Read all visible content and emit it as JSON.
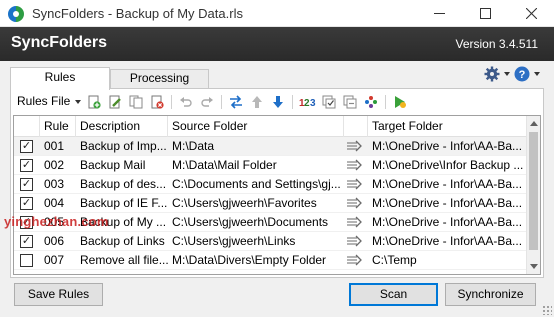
{
  "window": {
    "title": "SyncFolders - Backup of My Data.rls",
    "min_icon": "minimize-icon",
    "max_icon": "maximize-icon",
    "close_icon": "close-icon"
  },
  "header": {
    "app_name": "SyncFolders",
    "version": "Version 3.4.511"
  },
  "tabs": [
    {
      "label": "Rules",
      "active": true
    },
    {
      "label": "Processing",
      "active": false
    }
  ],
  "toolbar": {
    "rules_menu": "Rules File",
    "icons": [
      "add-rule-icon",
      "edit-rule-icon",
      "copy-rule-icon",
      "delete-rule-icon",
      "undo-icon",
      "redo-icon",
      "swap-direction-icon",
      "move-up-icon",
      "move-down-icon",
      "renumber-icon",
      "check-all-icon",
      "select-icon",
      "color-icon",
      "run-rule-icon"
    ]
  },
  "grid": {
    "columns": [
      "Rule",
      "Description",
      "Source Folder",
      "Target Folder"
    ],
    "rows": [
      {
        "checked": true,
        "rule": "001",
        "description": "Backup of Imp...",
        "source": "M:\\Data",
        "target": "M:\\OneDrive - Infor\\AA-Ba...",
        "selected": true
      },
      {
        "checked": true,
        "rule": "002",
        "description": "Backup Mail",
        "source": "M:\\Data\\Mail Folder",
        "target": "M:\\OneDrive\\Infor Backup ...",
        "selected": false
      },
      {
        "checked": true,
        "rule": "003",
        "description": "Backup of des...",
        "source": "C:\\Documents and Settings\\gj...",
        "target": "M:\\OneDrive - Infor\\AA-Ba...",
        "selected": false
      },
      {
        "checked": true,
        "rule": "004",
        "description": "Backup of IE F...",
        "source": "C:\\Users\\gjweerh\\Favorites",
        "target": "M:\\OneDrive - Infor\\AA-Ba...",
        "selected": false
      },
      {
        "checked": true,
        "rule": "005",
        "description": "Backup of My ...",
        "source": "C:\\Users\\gjweerh\\Documents",
        "target": "M:\\OneDrive - Infor\\AA-Ba...",
        "selected": false
      },
      {
        "checked": true,
        "rule": "006",
        "description": "Backup of Links",
        "source": "C:\\Users\\gjweerh\\Links",
        "target": "M:\\OneDrive - Infor\\AA-Ba...",
        "selected": false
      },
      {
        "checked": false,
        "rule": "007",
        "description": "Remove all file...",
        "source": "M:\\Data\\Divers\\Empty Folder",
        "target": "C:\\Temp",
        "selected": false
      }
    ]
  },
  "buttons": {
    "save": "Save Rules",
    "scan": "Scan",
    "synchronize": "Synchronize"
  },
  "watermark": "yinghezhan.com",
  "colors": {
    "header_bg": "#2f2f2f",
    "accent": "#0078d7"
  }
}
